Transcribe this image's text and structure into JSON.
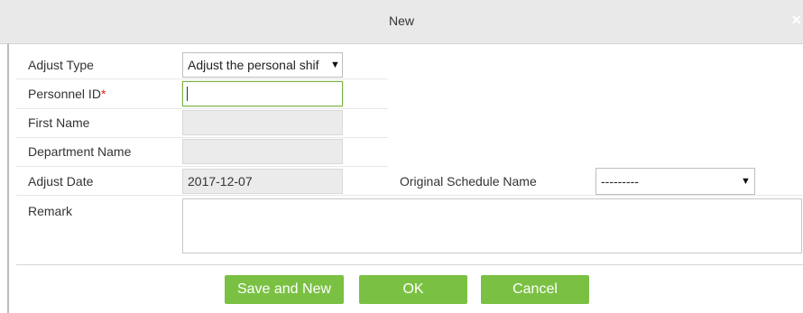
{
  "dialog": {
    "title": "New",
    "close_glyph": "×"
  },
  "form": {
    "adjust_type": {
      "label": "Adjust Type",
      "value": "Adjust the personal shif",
      "arrow": "▼"
    },
    "personnel_id": {
      "label": "Personnel ID",
      "required_mark": "*",
      "value": ""
    },
    "first_name": {
      "label": "First Name",
      "value": ""
    },
    "department_name": {
      "label": "Department Name",
      "value": ""
    },
    "adjust_date": {
      "label": "Adjust Date",
      "value": "2017-12-07"
    },
    "original_schedule_name": {
      "label": "Original Schedule Name",
      "value": "---------",
      "arrow": "▼"
    },
    "remark": {
      "label": "Remark",
      "value": ""
    }
  },
  "buttons": {
    "save_and_new": "Save and New",
    "ok": "OK",
    "cancel": "Cancel"
  },
  "colors": {
    "accent": "#7ac143",
    "focus_border": "#7cb342",
    "required": "#e02020",
    "title_bar": "#e9e9e9"
  }
}
